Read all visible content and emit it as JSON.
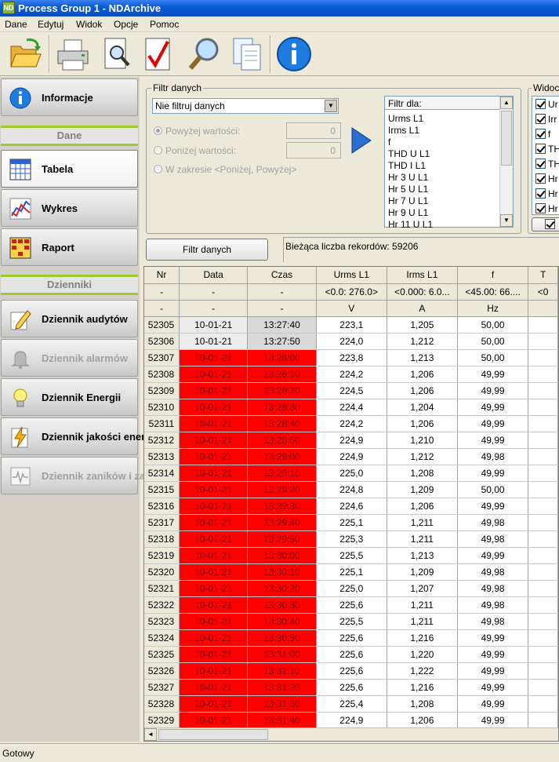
{
  "window": {
    "title": "Process Group 1 - NDArchive",
    "icon_text": "ND"
  },
  "menu": [
    "Dane",
    "Edytuj",
    "Widok",
    "Opcje",
    "Pomoc"
  ],
  "toolbar": [
    {
      "name": "open-folder-icon"
    },
    {
      "name": "printer-icon"
    },
    {
      "name": "print-preview-icon"
    },
    {
      "name": "check-icon"
    },
    {
      "name": "search-icon"
    },
    {
      "name": "copy-documents-icon"
    },
    {
      "name": "info-icon"
    }
  ],
  "sidebar": {
    "informacje": "Informacje",
    "section_dane": "Dane",
    "tabela": "Tabela",
    "wykres": "Wykres",
    "raport": "Raport",
    "section_dzienniki": "Dzienniki",
    "audytow": "Dziennik audytów",
    "alarmow": "Dziennik alarmów",
    "energii": "Dziennik Energii",
    "jakosci": "Dziennik jakości energii",
    "zanikow": "Dziennik zaników i zapadów"
  },
  "filter": {
    "group_title": "Filtr danych",
    "mode_selected": "Nie filtruj danych",
    "above_label": "Powyżej wartości:",
    "above_value": "0",
    "below_label": "Poniżej wartości:",
    "below_value": "0",
    "range_label": "W zakresie <Poniżej, Powyżej>",
    "filter_for_header": "Filtr dla:",
    "filter_for_items": [
      "Urms L1",
      "Irms L1",
      "f",
      "THD U L1",
      "THD I L1",
      "Hr 3 U L1",
      "Hr 5 U L1",
      "Hr 7 U L1",
      "Hr 9 U L1",
      "Hr 11 U L1"
    ],
    "apply_button": "Filtr danych",
    "record_count": "Bieżąca liczba rekordów: 59206"
  },
  "visibility": {
    "group_title": "Widoc",
    "items": [
      "Ur",
      "Irr",
      "f",
      "TH",
      "TH",
      "Hr",
      "Hr",
      "Hr"
    ]
  },
  "grid": {
    "headers": [
      "Nr",
      "Data",
      "Czas",
      "Urms L1",
      "Irms L1",
      "f",
      "T"
    ],
    "ranges": [
      "-",
      "-",
      "-",
      "<0.0: 276.0>",
      "<0.000: 6.0...",
      "<45.00: 66....",
      "<0"
    ],
    "units": [
      "-",
      "-",
      "-",
      "V",
      "A",
      "Hz",
      ""
    ],
    "rows": [
      [
        "52305",
        "10-01-21",
        "13:27:40",
        "223,1",
        "1,205",
        "50,00"
      ],
      [
        "52306",
        "10-01-21",
        "13:27:50",
        "224,0",
        "1,212",
        "50,00"
      ],
      [
        "52307",
        "10-01-21",
        "13:28:00",
        "223,8",
        "1,213",
        "50,00"
      ],
      [
        "52308",
        "10-01-21",
        "13:28:10",
        "224,2",
        "1,206",
        "49,99"
      ],
      [
        "52309",
        "10-01-21",
        "13:28:20",
        "224,5",
        "1,206",
        "49,99"
      ],
      [
        "52310",
        "10-01-21",
        "13:28:30",
        "224,4",
        "1,204",
        "49,99"
      ],
      [
        "52311",
        "10-01-21",
        "13:28:40",
        "224,2",
        "1,206",
        "49,99"
      ],
      [
        "52312",
        "10-01-21",
        "13:28:50",
        "224,9",
        "1,210",
        "49,99"
      ],
      [
        "52313",
        "10-01-21",
        "13:29:00",
        "224,9",
        "1,212",
        "49,98"
      ],
      [
        "52314",
        "10-01-21",
        "13:29:10",
        "225,0",
        "1,208",
        "49,99"
      ],
      [
        "52315",
        "10-01-21",
        "13:29:20",
        "224,8",
        "1,209",
        "50,00"
      ],
      [
        "52316",
        "10-01-21",
        "13:29:30",
        "224,6",
        "1,206",
        "49,99"
      ],
      [
        "52317",
        "10-01-21",
        "13:29:40",
        "225,1",
        "1,211",
        "49,98"
      ],
      [
        "52318",
        "10-01-21",
        "13:29:50",
        "225,3",
        "1,211",
        "49,98"
      ],
      [
        "52319",
        "10-01-21",
        "13:30:00",
        "225,5",
        "1,213",
        "49,99"
      ],
      [
        "52320",
        "10-01-21",
        "13:30:10",
        "225,1",
        "1,209",
        "49,98"
      ],
      [
        "52321",
        "10-01-21",
        "13:30:20",
        "225,0",
        "1,207",
        "49,98"
      ],
      [
        "52322",
        "10-01-21",
        "13:30:30",
        "225,6",
        "1,211",
        "49,98"
      ],
      [
        "52323",
        "10-01-21",
        "13:30:40",
        "225,5",
        "1,211",
        "49,98"
      ],
      [
        "52324",
        "10-01-21",
        "13:30:50",
        "225,6",
        "1,216",
        "49,99"
      ],
      [
        "52325",
        "10-01-21",
        "13:31:00",
        "225,6",
        "1,220",
        "49,99"
      ],
      [
        "52326",
        "10-01-21",
        "13:31:10",
        "225,6",
        "1,222",
        "49,99"
      ],
      [
        "52327",
        "10-01-21",
        "13:31:20",
        "225,6",
        "1,216",
        "49,99"
      ],
      [
        "52328",
        "10-01-21",
        "13:31:30",
        "225,4",
        "1,208",
        "49,99"
      ],
      [
        "52329",
        "10-01-21",
        "13:31:40",
        "224,9",
        "1,206",
        "49,99"
      ]
    ],
    "highlight_from_row": 2,
    "highlight_color": "#ff0000"
  },
  "status": "Gotowy"
}
